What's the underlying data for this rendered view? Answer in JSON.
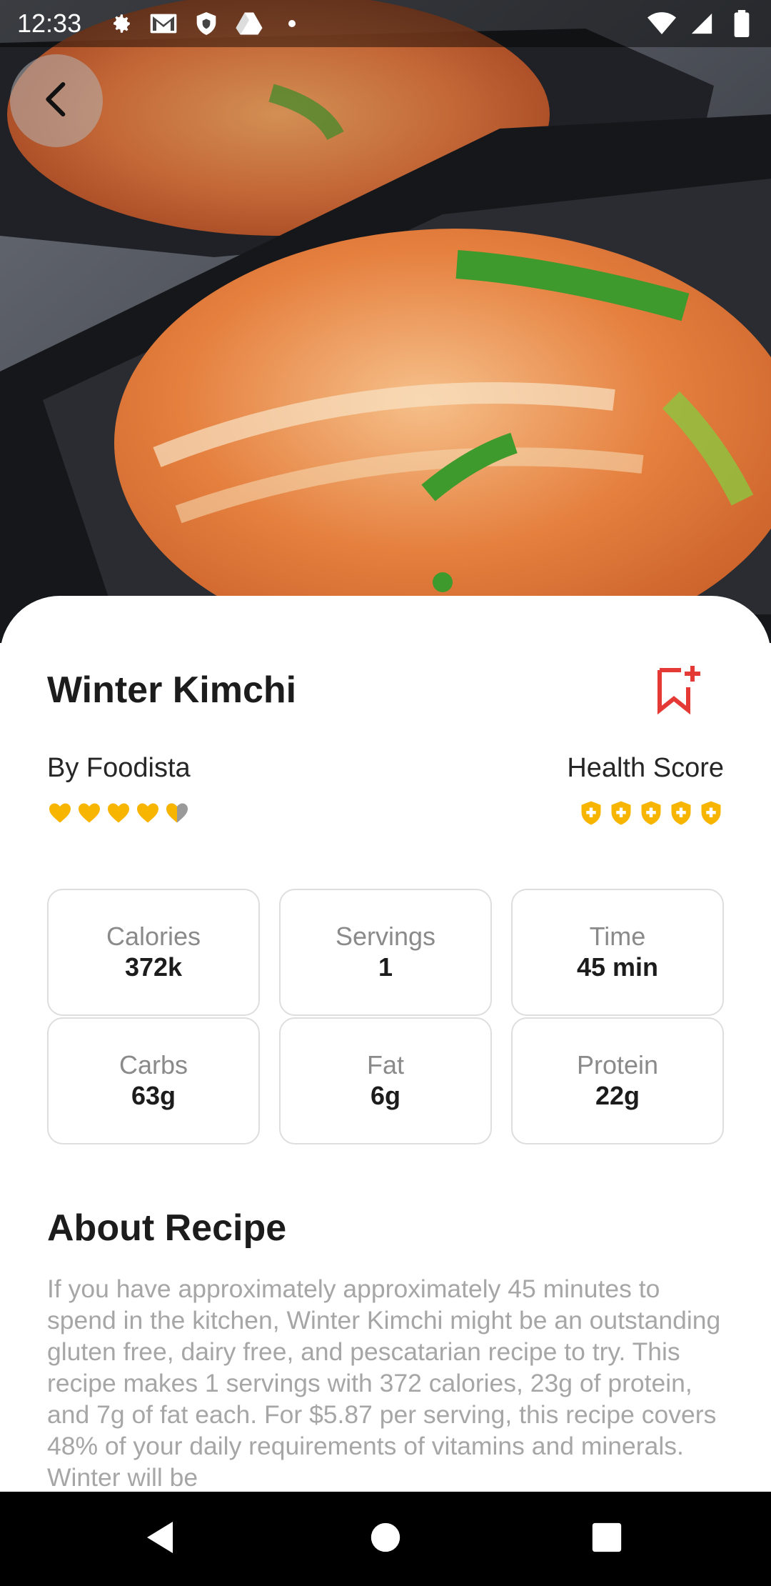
{
  "status_bar": {
    "time": "12:33",
    "left_icons": [
      "settings-icon",
      "gmail-icon",
      "shield-icon",
      "drive-icon",
      "dot-icon"
    ],
    "right_icons": [
      "wifi-icon",
      "signal-icon",
      "battery-icon"
    ]
  },
  "hero": {
    "image_subject": "kimchi-photo"
  },
  "recipe": {
    "title": "Winter Kimchi",
    "author": "By Foodista",
    "health_label": "Health Score",
    "rating_hearts": 4.5,
    "health_score_shields": 5,
    "stats": [
      {
        "label": "Calories",
        "value": "372k"
      },
      {
        "label": "Servings",
        "value": "1"
      },
      {
        "label": "Time",
        "value": "45 min"
      },
      {
        "label": "Carbs",
        "value": "63g"
      },
      {
        "label": "Fat",
        "value": "6g"
      },
      {
        "label": "Protein",
        "value": "22g"
      }
    ],
    "about_heading": "About Recipe",
    "about_text": "If you have approximately approximately 45 minutes to spend in the kitchen, Winter Kimchi might be an outstanding gluten free, dairy free, and pescatarian recipe to try. This recipe makes 1 servings with 372 calories, 23g of protein, and 7g of fat each. For $5.87 per serving, this recipe covers 48% of your daily requirements of vitamins and minerals. Winter will be"
  },
  "colors": {
    "accent_red": "#e53935",
    "star_yellow": "#f7b500",
    "text_dark": "#1c1c1c",
    "text_muted": "#a6a6a6"
  },
  "nav": {
    "icons": [
      "back-triangle-icon",
      "home-circle-icon",
      "recents-square-icon"
    ]
  }
}
